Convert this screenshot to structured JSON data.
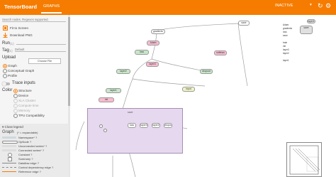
{
  "header": {
    "title": "TensorBoard",
    "tab_graphs": "GRAPHS",
    "status": "INACTIVE",
    "status_caret": "▾",
    "refresh_icon": "↻",
    "settings_icon": "⚙",
    "colors": {
      "brand": "#f57c00"
    }
  },
  "sidebar": {
    "search_placeholder": "Search nodes. Regexes supported.",
    "fit_label": "Fit to Screen",
    "download_label": "Download PNG",
    "run_label": "Run",
    "run_count": "(1)",
    "run_value": "",
    "tag_label": "Tag",
    "tag_count": "(1)",
    "tag_value": "Default",
    "upload_label": "Upload",
    "choose_file": "Choose File",
    "graph_options": [
      "Graph",
      "Conceptual Graph",
      "Profile"
    ],
    "trace_label": "Trace inputs",
    "color_label": "Color",
    "color_options": [
      "Structure",
      "Device",
      "XLA Cluster",
      "Compute time",
      "Memory",
      "TPU Compatibility"
    ]
  },
  "legend": {
    "toggle": "Close legend",
    "title": "Graph",
    "subtitle": "(* = expandable)",
    "items": [
      "Namespace*",
      "OpNode",
      "Unconnected series*",
      "Connected series*",
      "Constant",
      "Summary",
      "Dataflow edge",
      "Control dependency edge",
      "Reference edge"
    ],
    "item_suffixes": [
      "?",
      "?",
      "?",
      "?",
      "?",
      "?",
      "?",
      "?",
      "?"
    ]
  },
  "graph": {
    "nodes": [
      {
        "id": "n1",
        "label": "save"
      },
      {
        "id": "n2",
        "label": "gradients"
      },
      {
        "id": "n3",
        "label": "Adam"
      },
      {
        "id": "n4",
        "label": "loss"
      },
      {
        "id": "n5",
        "label": "softmax"
      },
      {
        "id": "n6",
        "label": "layer3"
      },
      {
        "id": "n7",
        "label": "layer2"
      },
      {
        "id": "n8",
        "label": "dropout"
      },
      {
        "id": "n9",
        "label": "layer1"
      },
      {
        "id": "n10",
        "label": "input"
      },
      {
        "id": "n11",
        "label": "init"
      },
      {
        "id": "n12",
        "label": "init"
      }
    ],
    "side_panel": [
      "Adam",
      "gradients",
      "loss",
      "save",
      "train",
      "init",
      "layer3",
      "layer2",
      "layer1",
      "input",
      "dropout",
      "softmax"
    ]
  }
}
